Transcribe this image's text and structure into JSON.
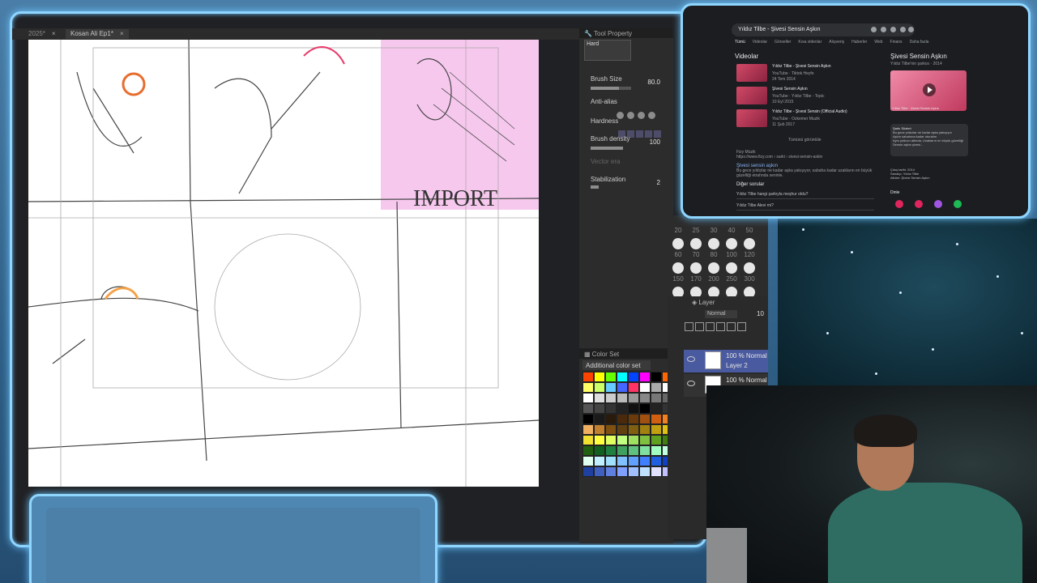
{
  "app": {
    "tabs": [
      {
        "label": "2025*"
      },
      {
        "label": "Kosan Ali Ep1*"
      }
    ],
    "canvas_text": "IMPORT",
    "tool_property": {
      "header": "Tool Property",
      "brush_name": "Hard",
      "brush_size_label": "Brush Size",
      "brush_size_value": "80.0",
      "anti_alias_label": "Anti-alias",
      "hardness_label": "Hardness",
      "brush_density_label": "Brush density",
      "brush_density_value": "100",
      "vector_label": "Vector era",
      "stabilization_label": "Stabilization",
      "stabilization_value": "2"
    },
    "brush_sizes": [
      "20",
      "25",
      "30",
      "40",
      "50",
      "60",
      "70",
      "80",
      "100",
      "120",
      "150",
      "170",
      "200",
      "250",
      "300"
    ],
    "layer_panel": {
      "header": "Layer",
      "blend_mode": "Normal",
      "opacity": "10",
      "layers": [
        {
          "mode": "100 % Normal",
          "name": "Layer 2"
        },
        {
          "mode": "100 % Normal",
          "name": ""
        }
      ]
    },
    "color_set": {
      "header": "Color Set",
      "selected_set": "Additional color set",
      "swatches": [
        "#ff4400",
        "#ffff00",
        "#66ff00",
        "#00ffff",
        "#0044ff",
        "#ff00ff",
        "#000000",
        "#ff6600",
        "#ffff66",
        "#ccff66",
        "#66ccff",
        "#4466ff",
        "#ff3366",
        "#ffffff",
        "#aaaaaa",
        "#ffffff",
        "#ffffff",
        "#dddddd",
        "#cccccc",
        "#bbbbbb",
        "#999999",
        "#888888",
        "#777777",
        "#666666",
        "#555555",
        "#444444",
        "#333333",
        "#222222",
        "#111111",
        "#000000",
        "#222222",
        "#333333",
        "#000000",
        "#1a1a1a",
        "#2a1a0a",
        "#4a2a0a",
        "#6a3a0a",
        "#a05010",
        "#d06010",
        "#f08020",
        "#f0b060",
        "#c08030",
        "#805010",
        "#604010",
        "#806010",
        "#a08010",
        "#c0a010",
        "#e0c010",
        "#f0e030",
        "#ffff40",
        "#e0ff60",
        "#c0ff80",
        "#a0e060",
        "#80c040",
        "#60a020",
        "#408010",
        "#206010",
        "#106020",
        "#208040",
        "#40a060",
        "#60c080",
        "#80e0a0",
        "#a0ffc0",
        "#c0ffe0",
        "#e0fff0",
        "#c0f0ff",
        "#a0e0ff",
        "#80c0ff",
        "#60a0ff",
        "#4080ff",
        "#2060e0",
        "#1040c0",
        "#2040a0",
        "#4060c0",
        "#6080e0",
        "#80a0ff",
        "#a0c0ff",
        "#c0e0ff",
        "#e0e0ff",
        "#c0c0ff"
      ]
    }
  },
  "browser": {
    "query": "Yıldız Tilbe - Şivesi Sensin Aşkın",
    "tabs": [
      "Tümü",
      "Videolar",
      "Görseller",
      "Kısa videolar",
      "Alışveriş",
      "Haberler",
      "Web",
      "Finans",
      "Daha fazla"
    ],
    "videos_header": "Videolar",
    "videos": [
      {
        "title": "Yıldız Tilbe - Şivesi Sensin Aşkın",
        "channel": "YouTube · Tiktok Heyfe",
        "date": "24 Tem 2014"
      },
      {
        "title": "Şivesi Sensin Aşkın",
        "channel": "YouTube · Yıldız Tilbe - Topic",
        "date": "10 Eyl 2015"
      },
      {
        "title": "Yıldız Tilbe - Şivesi Sensin (Official Audio)",
        "channel": "YouTube · Ozkemer Muzik",
        "date": "11 Şub 2017"
      }
    ],
    "show_all": "Tümünü görüntüle",
    "site_name": "Fizy Müzik",
    "site_url": "https://www.fizy.com › sarki › sivesi-sensin-askin",
    "site_title": "Şivesi sensin aşkın",
    "site_snippet": "Bu gece yıldızlar ne kadar aşka yakışıyor, sabaha kadar uzakların en büyük güzelliği etrafında seninle.",
    "other_questions": "Diğer sorular",
    "questions": [
      "Yıldız Tilbe hangi şarkıyla meşhur oldu?",
      "Yıldız Tilbe Alevi mi?"
    ],
    "kp_title": "Şivesi Sensin Aşkın",
    "kp_subtitle": "Yıldız Tilbe'nin şarkısı · 2014",
    "kp_caption": "Yıldız Tilbe · Şivesi Sensin Aşkın",
    "lyrics_label": "Şarkı Sözleri",
    "lyrics_lines": [
      "Bu gece yıldızlar ne kadar aşka yakışıyor",
      "Aşkın sabahına kadar oturalım",
      "Aynı yıldızın altında, Uzakların en büyük güzelliği",
      "Sensin aşkın şivesi..."
    ],
    "facts": [
      "Çıkış tarihi: 2014",
      "Sanatçı: Yıldız Tilbe",
      "Albüm: Şivesi Sensin Aşkın"
    ],
    "listen_label": "Dinle"
  },
  "colors": {
    "frame_glow": "#8fd6ff",
    "app_bg": "#202124",
    "browser_bg": "#1c1d20",
    "layer_selected": "#4a5aa0"
  }
}
